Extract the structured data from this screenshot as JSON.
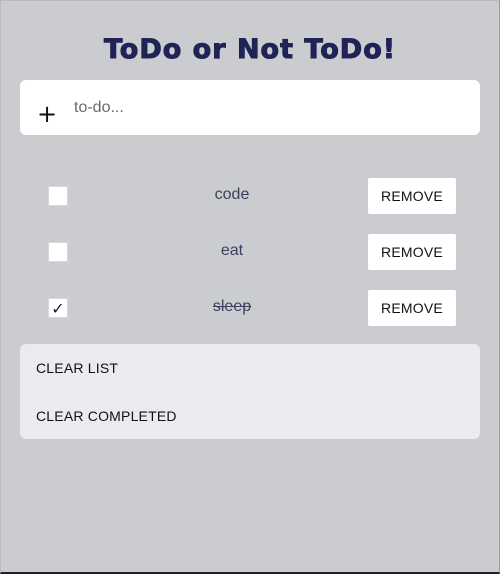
{
  "app": {
    "title": "ToDo or Not ToDo!"
  },
  "input": {
    "plus_icon": "plus-icon",
    "placeholder": "to-do...",
    "value": ""
  },
  "todos": [
    {
      "label": "code",
      "completed": false,
      "remove_label": "REMOVE"
    },
    {
      "label": "eat",
      "completed": false,
      "remove_label": "REMOVE"
    },
    {
      "label": "sleep",
      "completed": true,
      "remove_label": "REMOVE"
    }
  ],
  "actions": {
    "clear_list": "CLEAR LIST",
    "clear_completed": "CLEAR COMPLETED"
  },
  "colors": {
    "background": "#cbccd0",
    "title": "#1f2356",
    "panel": "#eaebef"
  }
}
